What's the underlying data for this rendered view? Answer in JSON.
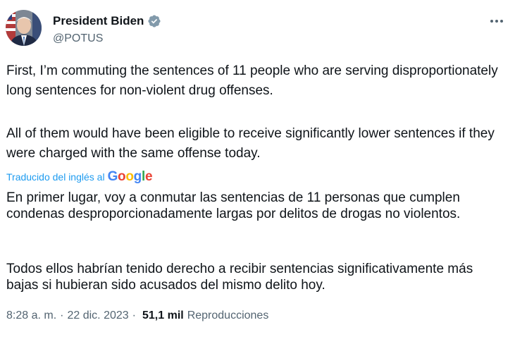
{
  "author": {
    "name": "President Biden",
    "handle": "@POTUS",
    "avatar_icon": "avatar-portrait",
    "verified_badge_color": "#829aab"
  },
  "tweet": {
    "paragraph_1": "First, I’m commuting the sentences of 11 people who are serving disproportionately long sentences for non-violent drug offenses.",
    "paragraph_2": "All of them would have been eligible to receive significantly lower sentences if they were charged with the same offense today."
  },
  "translation": {
    "label": "Traducido del inglés al",
    "provider": "Google",
    "paragraph_1": "En primer lugar, voy a conmutar las sentencias de 11 personas que cumplen condenas desproporcionadamente largas por delitos de drogas no violentos.",
    "paragraph_2": "Todos ellos habrían tenido derecho a recibir sentencias significativamente más bajas si hubieran sido acusados del mismo delito hoy."
  },
  "meta": {
    "time": "8:28 a. m.",
    "separator": "·",
    "date": "22 dic. 2023",
    "views_count": "51,1 mil",
    "views_label": "Reproducciones"
  },
  "colors": {
    "link_blue": "#1d9bf0",
    "text_primary": "#0f1419",
    "text_secondary": "#536471"
  }
}
